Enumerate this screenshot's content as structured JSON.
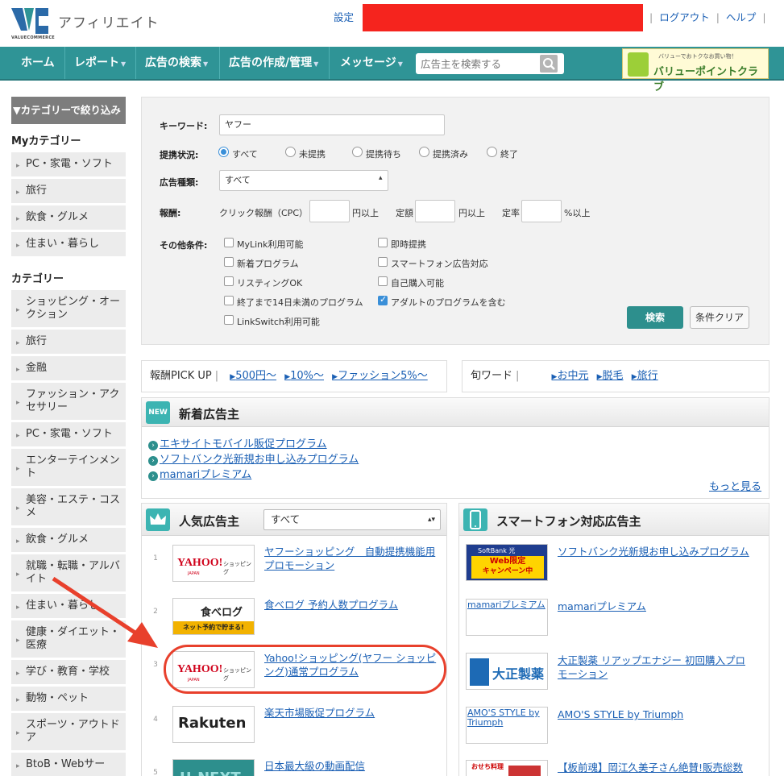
{
  "header": {
    "logo_text": "アフィリエイト",
    "logo_sub": "VALUECOMMERCE",
    "settings": "設定",
    "logout": "ログアウト",
    "help": "ヘルプ",
    "sep": "|"
  },
  "nav": {
    "items": [
      {
        "label": "ホーム",
        "caret": ""
      },
      {
        "label": "レポート",
        "caret": "▼"
      },
      {
        "label": "広告の検索",
        "caret": "▼"
      },
      {
        "label": "広告の作成/管理",
        "caret": "▼"
      },
      {
        "label": "メッセージ",
        "caret": "▼"
      }
    ],
    "search_placeholder": "広告主を検索する",
    "banner_small": "バリューでおトクなお買い物！",
    "banner_big": "バリューポイントクラブ"
  },
  "sidebar": {
    "filter_head": "▼カテゴリーで絞り込み",
    "my_title": "Myカテゴリー",
    "my_items": [
      "PC・家電・ソフト",
      "旅行",
      "飲食・グルメ",
      "住まい・暮らし"
    ],
    "cat_title": "カテゴリー",
    "cat_items": [
      "ショッピング・オークション",
      "旅行",
      "金融",
      "ファッション・アクセサリー",
      "PC・家電・ソフト",
      "エンターテインメント",
      "美容・エステ・コスメ",
      "飲食・グルメ",
      "就職・転職・アルバイト",
      "住まい・暮らし",
      "健康・ダイエット・医療",
      "学び・教育・学校",
      "動物・ペット",
      "スポーツ・アウトドア",
      "BtoB・Webサー"
    ]
  },
  "search": {
    "keyword_label": "キーワード:",
    "keyword_value": "ヤフー",
    "status_label": "提携状況:",
    "status_options": [
      "すべて",
      "未提携",
      "提携待ち",
      "提携済み",
      "終了"
    ],
    "type_label": "広告種類:",
    "type_value": "すべて",
    "reward_label": "報酬:",
    "click_label": "クリック報酬（CPC）",
    "yen_over": "円以上",
    "fixed_label": "定額",
    "rate_label": "定率",
    "pct_over": "%以上",
    "other_label": "その他条件:",
    "checks_left": [
      "MyLink利用可能",
      "新着プログラム",
      "リスティングOK",
      "終了まで14日未満のプログラム",
      "LinkSwitch利用可能"
    ],
    "checks_right": [
      "即時提携",
      "スマートフォン広告対応",
      "自己購入可能",
      "アダルトのプログラムを含む"
    ],
    "search_button": "検索",
    "clear_button": "条件クリア"
  },
  "pickup": {
    "label": "報酬PICK UP",
    "links": [
      "500円〜",
      "10%〜",
      "ファッション5%〜"
    ],
    "word_label": "旬ワード",
    "words": [
      "お中元",
      "脱毛",
      "旅行"
    ]
  },
  "new_advertisers": {
    "badge": "NEW",
    "title": "新着広告主",
    "items": [
      "エキサイトモバイル販促プログラム",
      "ソフトバンク光新規お申し込みプログラム",
      "mamariプレミアム"
    ],
    "more": "もっと見る"
  },
  "popular": {
    "title": "人気広告主",
    "select_value": "すべて",
    "rows": [
      {
        "rank": "1",
        "thumb": "yahoo",
        "name": "ヤフーショッピング　自動提携機能用プロモーション"
      },
      {
        "rank": "2",
        "thumb": "tabelog",
        "name": "食べログ 予約人数プログラム"
      },
      {
        "rank": "3",
        "thumb": "yahoo",
        "name": "Yahoo!ショッピング(ヤフー ショッピング)通常プログラム"
      },
      {
        "rank": "4",
        "thumb": "rakuten",
        "name": "楽天市場販促プログラム"
      },
      {
        "rank": "5",
        "thumb": "unext",
        "name": "日本最大級の動画配信"
      }
    ],
    "yahoo_logo": "YAHOO!",
    "yahoo_shop": "ショッピング",
    "yahoo_japan": "JAPAN",
    "tabelog_logo": "食べログ",
    "tabelog_bar": "ネット予約で貯まる!",
    "rakuten_logo": "Rakuten",
    "unext_logo": "U-NEXT"
  },
  "smartphone": {
    "title": "スマートフォン対応広告主",
    "rows": [
      {
        "thumb": "softbank",
        "caption": "",
        "name": "ソフトバンク光新規お申し込みプログラム"
      },
      {
        "thumb": "text",
        "caption": "mamariプレミアム",
        "name": "mamariプレミアム"
      },
      {
        "thumb": "taisho",
        "caption": "",
        "name": "大正製薬 リアップエナジー 初回購入プロモーション"
      },
      {
        "thumb": "text",
        "caption": "AMO'S STYLE by Triumph",
        "name": "AMO'S STYLE by Triumph"
      },
      {
        "thumb": "osechi",
        "caption": "",
        "name": "【板前魂】岡江久美子さん絶賛!販売総数93"
      }
    ],
    "softbank_top": "SoftBank 光",
    "softbank_mid": "Web限定",
    "softbank_bot": "キャンペーン中",
    "taisho_logo": "大正製薬",
    "osechi_logo": "おせち料理"
  },
  "colors": {
    "nav": "#2f9496",
    "accent": "#3cb4b2",
    "link": "#1a5fb4",
    "annotation": "#e8402c",
    "redact": "#f5241e"
  }
}
